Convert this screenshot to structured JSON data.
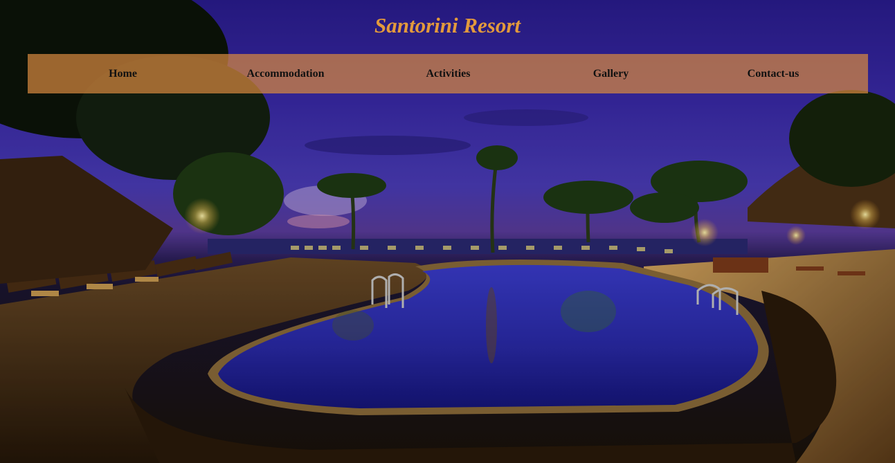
{
  "site": {
    "title": "Santorini Resort"
  },
  "nav": {
    "items": [
      {
        "label": "Home"
      },
      {
        "label": "Accommodation"
      },
      {
        "label": "Activities"
      },
      {
        "label": "Gallery"
      },
      {
        "label": "Contact-us"
      }
    ]
  },
  "colors": {
    "title": "#e39a3c",
    "navbar_bg": "#d68840",
    "nav_text": "#111111"
  },
  "hero": {
    "image": "night-pool-resort-photo"
  }
}
